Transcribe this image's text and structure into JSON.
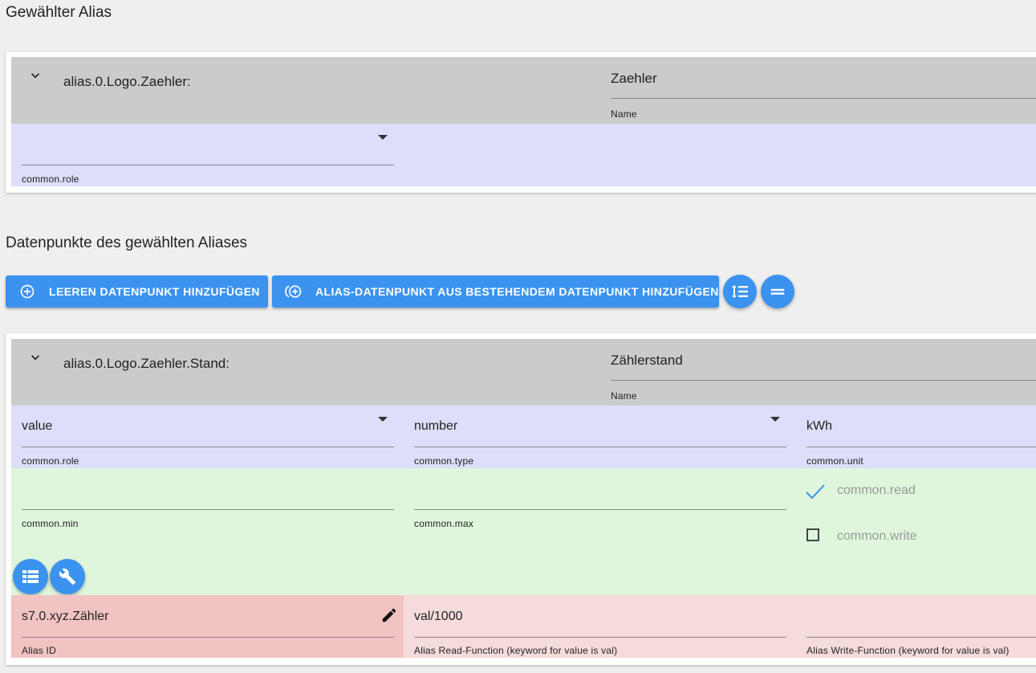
{
  "selected_alias": {
    "section_title": "Gewählter Alias",
    "alias_id": "alias.0.Logo.Zaehler:",
    "name_value": "Zaehler",
    "name_label": "Name",
    "role_value": "",
    "role_label": "common.role"
  },
  "datapoints": {
    "section_title": "Datenpunkte des gewählten Aliases",
    "add_empty_label": "LEEREN DATENPUNKT HINZUFÜGEN",
    "add_existing_label": "ALIAS-DATENPUNKT AUS BESTEHENDEM DATENPUNKT HINZUFÜGEN"
  },
  "datapoint": {
    "alias_id": "alias.0.Logo.Zaehler.Stand:",
    "name_value": "Zählerstand",
    "name_label": "Name",
    "role_value": "value",
    "role_label": "common.role",
    "type_value": "number",
    "type_label": "common.type",
    "unit_value": "kWh",
    "unit_label": "common.unit",
    "min_value": "",
    "min_label": "common.min",
    "max_value": "",
    "max_label": "common.max",
    "read_label": "common.read",
    "read_checked": true,
    "write_label": "common.write",
    "write_checked": false,
    "alias_target_value": "s7.0.xyz.Zähler",
    "alias_target_label": "Alias ID",
    "read_function_value": "val/1000",
    "read_function_label": "Alias Read-Function (keyword for value is val)",
    "write_function_value": "",
    "write_function_label": "Alias Write-Function (keyword for value is val)"
  },
  "colors": {
    "accent": "#3b93ef",
    "header_gray": "#cbcbcb",
    "lavender": "#dddef9",
    "green": "#dff6dd",
    "pink": "#f6dbdb",
    "pink_dark": "#f2c3c3"
  },
  "icons": [
    "chevron-down-icon",
    "add-circle-icon",
    "add-circle-linked-icon",
    "expand-rows-icon",
    "collapse-rows-icon",
    "table-icon",
    "wrench-icon",
    "pencil-icon",
    "checkmark-icon",
    "checkbox-icon"
  ]
}
